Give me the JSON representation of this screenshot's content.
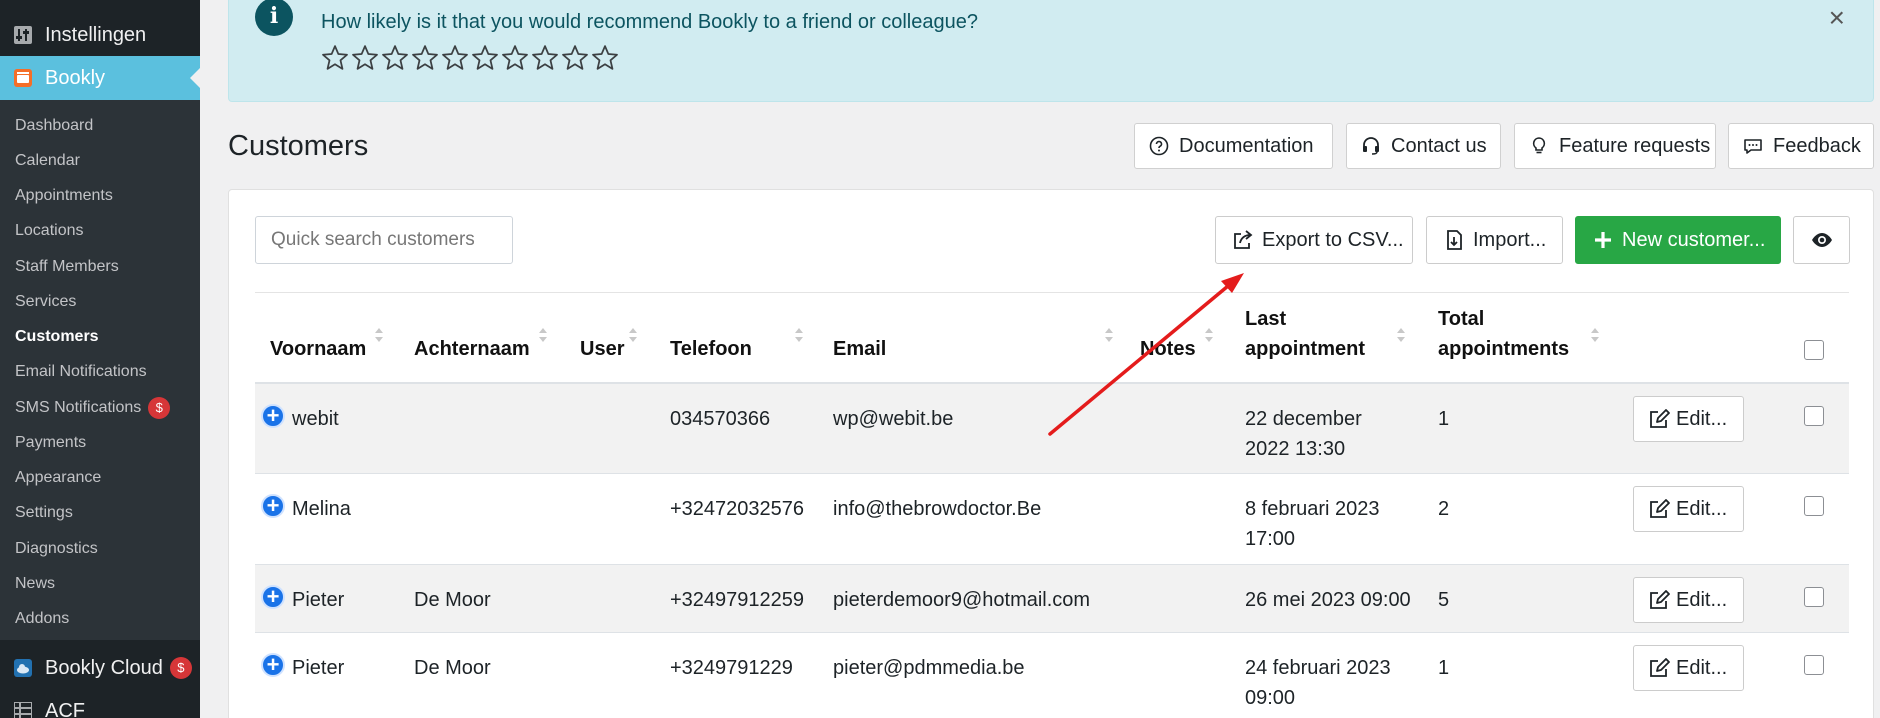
{
  "sidebar": {
    "instellingen": "Instellingen",
    "bookly": "Bookly",
    "items": [
      "Dashboard",
      "Calendar",
      "Appointments",
      "Locations",
      "Staff Members",
      "Services",
      "Customers",
      "Email Notifications",
      "SMS Notifications",
      "Payments",
      "Appearance",
      "Settings",
      "Diagnostics",
      "News",
      "Addons"
    ],
    "active_item": "Customers",
    "sms_badge": "$",
    "bookly_cloud": "Bookly Cloud",
    "cloud_badge": "$",
    "acf": "ACF"
  },
  "notice": {
    "text": "How likely is it that you would recommend Bookly to a friend or colleague?",
    "star_count": 10,
    "icon": "info-icon",
    "close": "×"
  },
  "header": {
    "title": "Customers",
    "documentation": "Documentation",
    "contact": "Contact us",
    "feature_requests": "Feature requests",
    "feedback": "Feedback"
  },
  "toolbar": {
    "search_placeholder": "Quick search customers",
    "export": "Export to CSV...",
    "import": "Import...",
    "new_customer": "New customer...",
    "eye_icon": "eye-icon"
  },
  "table": {
    "columns": {
      "first_name": "Voornaam",
      "last_name": "Achternaam",
      "user": "User",
      "phone": "Telefoon",
      "email": "Email",
      "notes": "Notes",
      "last_appointment_1": "Last",
      "last_appointment_2": "appointment",
      "total_appointments_1": "Total",
      "total_appointments_2": "appointments"
    },
    "edit_label": "Edit...",
    "rows": [
      {
        "first": "webit",
        "last": "",
        "user": "",
        "phone": "034570366",
        "email": "wp@webit.be",
        "last_appt_1": "22 december",
        "last_appt_2": "2022 13:30",
        "total": "1"
      },
      {
        "first": "Melina",
        "last": "",
        "user": "",
        "phone": "+32472032576",
        "email": "info@thebrowdoctor.Be",
        "last_appt_1": "8 februari 2023",
        "last_appt_2": "17:00",
        "total": "2"
      },
      {
        "first": "Pieter",
        "last": "De Moor",
        "user": "",
        "phone": "+32497912259",
        "email": "pieterdemoor9@hotmail.com",
        "last_appt_1": "26 mei 2023 09:00",
        "last_appt_2": "",
        "total": "5"
      },
      {
        "first": "Pieter",
        "last": "De Moor",
        "user": "",
        "phone": "+3249791229",
        "email": "pieter@pdmmedia.be",
        "last_appt_1": "24 februari 2023",
        "last_appt_2": "09:00",
        "total": "1"
      }
    ]
  },
  "colors": {
    "sidebar_bg": "#1d2327",
    "bookly_active": "#5bc0de",
    "notice_bg": "#d1ecf1",
    "new_customer_green": "#28a745",
    "badge_red": "#d63638",
    "annotation_arrow": "#e41c1c"
  }
}
